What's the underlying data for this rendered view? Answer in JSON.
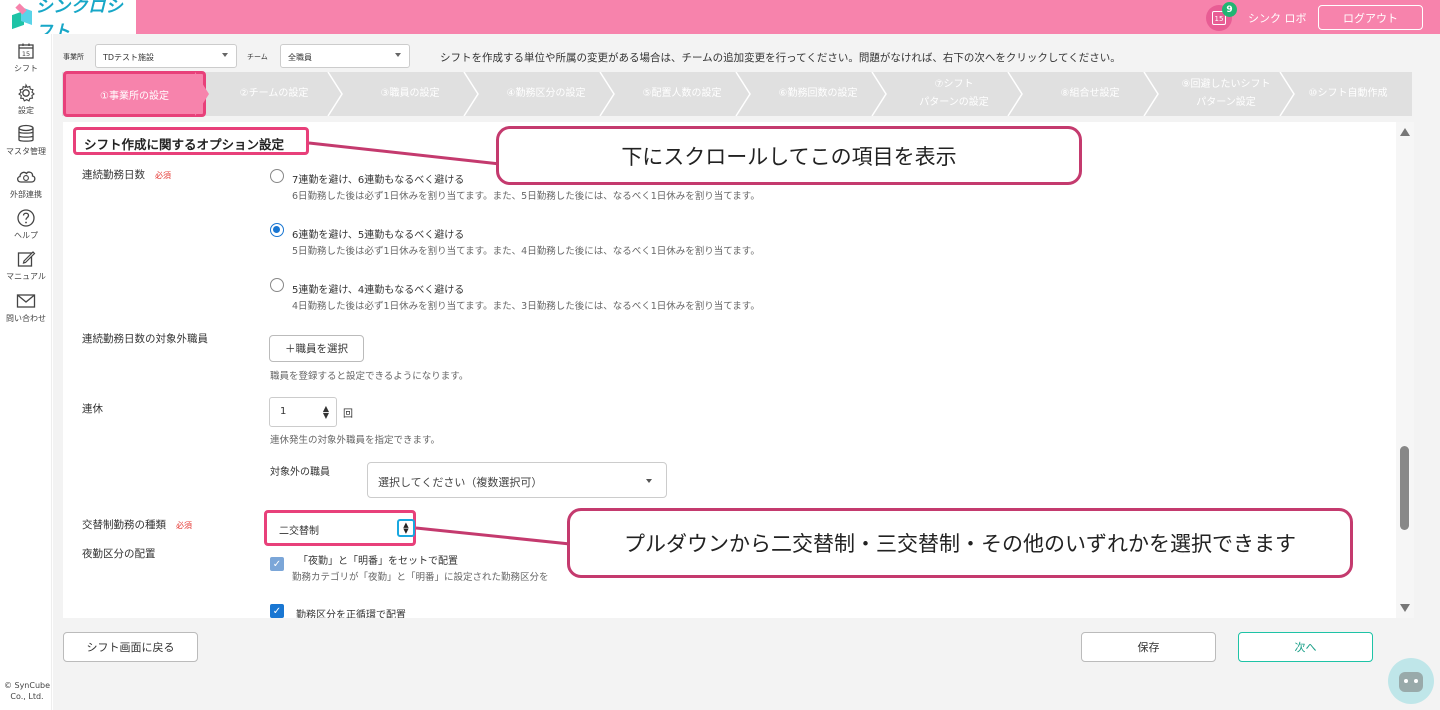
{
  "app": {
    "logo_text": "シンクロシフト",
    "notification_count": "9",
    "calendar_day": "15",
    "user_name": "シンク ロボ",
    "logout_label": "ログアウト"
  },
  "sidebar": {
    "items": [
      {
        "label": "シフト",
        "icon": "calendar-icon",
        "calendar_day": "15"
      },
      {
        "label": "設定",
        "icon": "gear-icon"
      },
      {
        "label": "マスタ管理",
        "icon": "database-icon"
      },
      {
        "label": "外部連携",
        "icon": "cloud-sync-icon"
      },
      {
        "label": "ヘルプ",
        "icon": "help-icon"
      },
      {
        "label": "マニュアル",
        "icon": "manual-edit-icon"
      },
      {
        "label": "問い合わせ",
        "icon": "mail-icon"
      }
    ],
    "copyright": "© SynCube Co., Ltd."
  },
  "filters": {
    "office_label": "事業所",
    "office_value": "TDテスト施設",
    "team_label": "チーム",
    "team_value": "全職員",
    "info_text": "シフトを作成する単位や所属の変更がある場合は、チームの追加変更を行ってください。問題がなければ、右下の次へをクリックしてください。"
  },
  "steps": [
    {
      "label": "①事業所の設定"
    },
    {
      "label": "②チームの設定"
    },
    {
      "label": "③職員の設定"
    },
    {
      "label": "④勤務区分の設定"
    },
    {
      "label": "⑤配置人数の設定"
    },
    {
      "label": "⑥勤務回数の設定"
    },
    {
      "label_line1": "⑦シフト",
      "label_line2": "パターンの設定"
    },
    {
      "label": "⑧組合せ設定"
    },
    {
      "label_line1": "⑨回避したいシフト",
      "label_line2": "パターン設定"
    },
    {
      "label": "⑩シフト自動作成"
    }
  ],
  "section": {
    "title": "シフト作成に関するオプション設定"
  },
  "consecutive": {
    "label": "連続勤務日数",
    "required": "必須",
    "options": [
      {
        "title": "7連勤を避け、6連勤もなるべく避ける",
        "desc": "6日勤務した後は必ず1日休みを割り当てます。また、5日勤務した後には、なるべく1日休みを割り当てます。",
        "selected": false
      },
      {
        "title": "6連勤を避け、5連勤もなるべく避ける",
        "desc": "5日勤務した後は必ず1日休みを割り当てます。また、4日勤務した後には、なるべく1日休みを割り当てます。",
        "selected": true
      },
      {
        "title": "5連勤を避け、4連勤もなるべく避ける",
        "desc": "4日勤務した後は必ず1日休みを割り当てます。また、3日勤務した後には、なるべく1日休みを割り当てます。",
        "selected": false
      }
    ]
  },
  "excluded_staff": {
    "label": "連続勤務日数の対象外職員",
    "button_label": "＋職員を選択",
    "note": "職員を登録すると設定できるようになります。"
  },
  "holidays": {
    "label": "連休",
    "value": "1",
    "unit": "回",
    "note": "連休発生の対象外職員を指定できます。",
    "target_label": "対象外の職員",
    "target_placeholder": "選択してください（複数選択可）"
  },
  "shift_system": {
    "label": "交替制勤務の種類",
    "required": "必須",
    "value": "二交替制"
  },
  "night_shift": {
    "label": "夜勤区分の配置",
    "check1_title": "「夜勤」と「明番」をセットで配置",
    "check1_desc": "勤務カテゴリが「夜勤」と「明番」に設定された勤務区分を",
    "check2_title": "勤務区分を正循環で配置"
  },
  "callouts": {
    "scroll": "下にスクロールしてこの項目を表示",
    "dropdown": "プルダウンから二交替制・三交替制・その他のいずれかを選択できます"
  },
  "footer": {
    "back_label": "シフト画面に戻る",
    "save_label": "保存",
    "next_label": "次へ"
  },
  "colors": {
    "brand_pink": "#f783ac",
    "highlight_red": "#e8407a",
    "accent_teal": "#1ec3a6",
    "radio_blue": "#1976d2"
  }
}
